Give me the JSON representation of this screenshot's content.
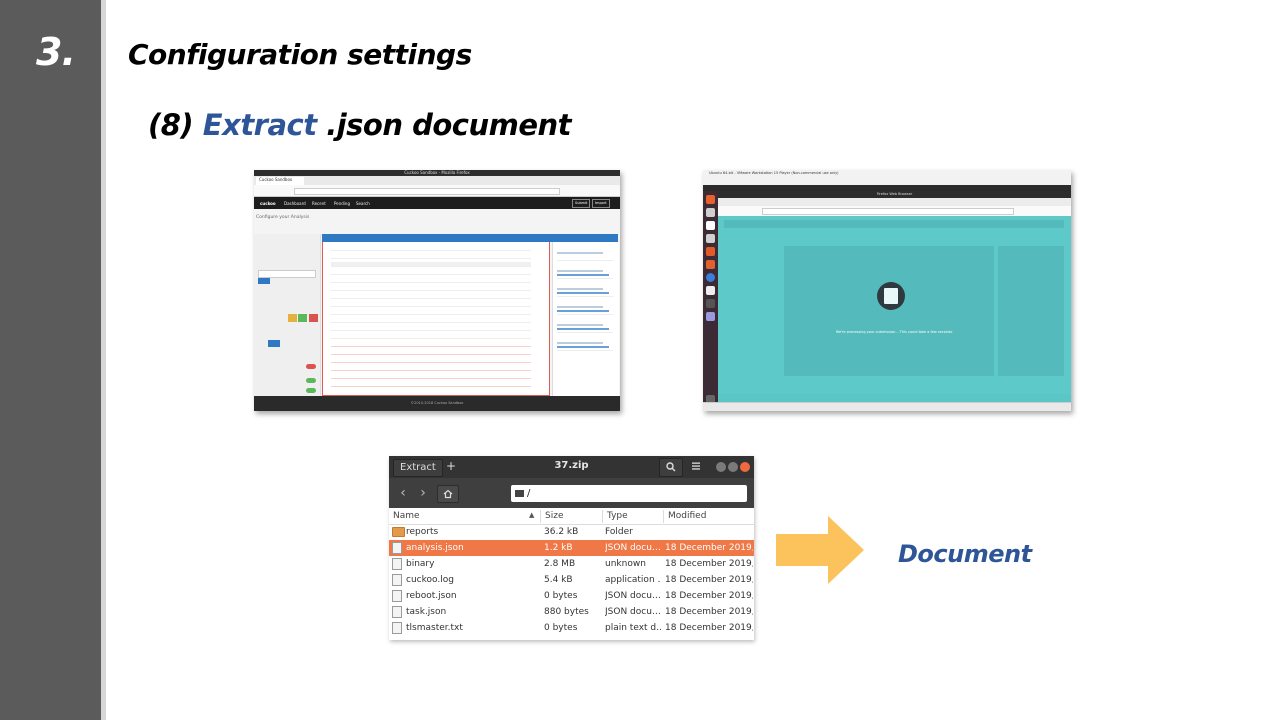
{
  "slide": {
    "step_number": "3.",
    "title": "Configuration settings",
    "subtitle_prefix": "(8) ",
    "subtitle_accent": "Extract",
    "subtitle_suffix": " .json document",
    "document_label": "Document",
    "accent_color": "#2e5597",
    "arrow_color": "#fcc25b"
  },
  "file_manager": {
    "tab_label": "Extract",
    "add_label": "+",
    "title": "37.zip",
    "search_icon": "search-icon",
    "menu_icon": "hamburger-menu-icon",
    "back_icon": "chevron-left-icon",
    "forward_icon": "chevron-right-icon",
    "home_icon": "home-icon",
    "path": "/",
    "columns": [
      "Name",
      "Size",
      "Type",
      "Modified"
    ],
    "files": [
      {
        "name": "reports",
        "size": "36.2 kB",
        "type": "Folder",
        "modified": "",
        "icon": "folder-icon",
        "selected": false
      },
      {
        "name": "analysis.json",
        "size": "1.2 kB",
        "type": "JSON docu…",
        "modified": "18 December 2019,…",
        "icon": "file-icon",
        "selected": true
      },
      {
        "name": "binary",
        "size": "2.8 MB",
        "type": "unknown",
        "modified": "18 December 2019,…",
        "icon": "file-icon",
        "selected": false
      },
      {
        "name": "cuckoo.log",
        "size": "5.4 kB",
        "type": "application …",
        "modified": "18 December 2019,…",
        "icon": "file-icon",
        "selected": false
      },
      {
        "name": "reboot.json",
        "size": "0 bytes",
        "type": "JSON docu…",
        "modified": "18 December 2019,…",
        "icon": "file-icon",
        "selected": false
      },
      {
        "name": "task.json",
        "size": "880 bytes",
        "type": "JSON docu…",
        "modified": "18 December 2019,…",
        "icon": "file-icon",
        "selected": false
      },
      {
        "name": "tlsmaster.txt",
        "size": "0 bytes",
        "type": "plain text d…",
        "modified": "18 December 2019,…",
        "icon": "file-icon",
        "selected": false
      }
    ],
    "selection_color": "#f07746"
  },
  "screenshot_1": {
    "window_title": "Cuckoo Sandbox - Mozilla Firefox",
    "tab_label": "Cuckoo Sandbox",
    "nav_items": [
      "Dashboard",
      "Recent",
      "Pending",
      "Search"
    ],
    "nav_buttons": [
      "Submit",
      "Import"
    ],
    "heading": "Configure your Analysis",
    "footer": "©2010-2018 Cuckoo Sandbox"
  },
  "screenshot_2": {
    "window_title": "Ubuntu 64-bit - VMware Workstation 15 Player (Non-commercial use only)",
    "browser_title": "Firefox Web Browser",
    "message": "We're processing your submission... This could take a few seconds."
  }
}
